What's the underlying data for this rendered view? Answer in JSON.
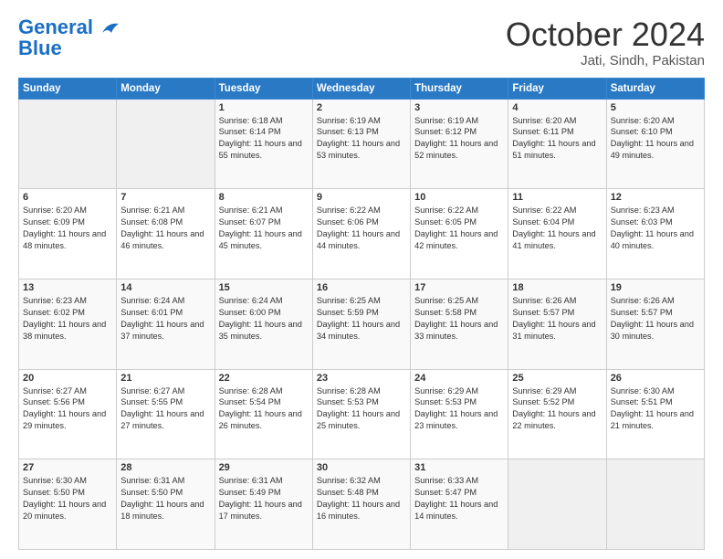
{
  "header": {
    "logo_line1": "General",
    "logo_line2": "Blue",
    "title": "October 2024",
    "location": "Jati, Sindh, Pakistan"
  },
  "days_of_week": [
    "Sunday",
    "Monday",
    "Tuesday",
    "Wednesday",
    "Thursday",
    "Friday",
    "Saturday"
  ],
  "weeks": [
    [
      {
        "day": "",
        "sunrise": "",
        "sunset": "",
        "daylight": ""
      },
      {
        "day": "",
        "sunrise": "",
        "sunset": "",
        "daylight": ""
      },
      {
        "day": "1",
        "sunrise": "Sunrise: 6:18 AM",
        "sunset": "Sunset: 6:14 PM",
        "daylight": "Daylight: 11 hours and 55 minutes."
      },
      {
        "day": "2",
        "sunrise": "Sunrise: 6:19 AM",
        "sunset": "Sunset: 6:13 PM",
        "daylight": "Daylight: 11 hours and 53 minutes."
      },
      {
        "day": "3",
        "sunrise": "Sunrise: 6:19 AM",
        "sunset": "Sunset: 6:12 PM",
        "daylight": "Daylight: 11 hours and 52 minutes."
      },
      {
        "day": "4",
        "sunrise": "Sunrise: 6:20 AM",
        "sunset": "Sunset: 6:11 PM",
        "daylight": "Daylight: 11 hours and 51 minutes."
      },
      {
        "day": "5",
        "sunrise": "Sunrise: 6:20 AM",
        "sunset": "Sunset: 6:10 PM",
        "daylight": "Daylight: 11 hours and 49 minutes."
      }
    ],
    [
      {
        "day": "6",
        "sunrise": "Sunrise: 6:20 AM",
        "sunset": "Sunset: 6:09 PM",
        "daylight": "Daylight: 11 hours and 48 minutes."
      },
      {
        "day": "7",
        "sunrise": "Sunrise: 6:21 AM",
        "sunset": "Sunset: 6:08 PM",
        "daylight": "Daylight: 11 hours and 46 minutes."
      },
      {
        "day": "8",
        "sunrise": "Sunrise: 6:21 AM",
        "sunset": "Sunset: 6:07 PM",
        "daylight": "Daylight: 11 hours and 45 minutes."
      },
      {
        "day": "9",
        "sunrise": "Sunrise: 6:22 AM",
        "sunset": "Sunset: 6:06 PM",
        "daylight": "Daylight: 11 hours and 44 minutes."
      },
      {
        "day": "10",
        "sunrise": "Sunrise: 6:22 AM",
        "sunset": "Sunset: 6:05 PM",
        "daylight": "Daylight: 11 hours and 42 minutes."
      },
      {
        "day": "11",
        "sunrise": "Sunrise: 6:22 AM",
        "sunset": "Sunset: 6:04 PM",
        "daylight": "Daylight: 11 hours and 41 minutes."
      },
      {
        "day": "12",
        "sunrise": "Sunrise: 6:23 AM",
        "sunset": "Sunset: 6:03 PM",
        "daylight": "Daylight: 11 hours and 40 minutes."
      }
    ],
    [
      {
        "day": "13",
        "sunrise": "Sunrise: 6:23 AM",
        "sunset": "Sunset: 6:02 PM",
        "daylight": "Daylight: 11 hours and 38 minutes."
      },
      {
        "day": "14",
        "sunrise": "Sunrise: 6:24 AM",
        "sunset": "Sunset: 6:01 PM",
        "daylight": "Daylight: 11 hours and 37 minutes."
      },
      {
        "day": "15",
        "sunrise": "Sunrise: 6:24 AM",
        "sunset": "Sunset: 6:00 PM",
        "daylight": "Daylight: 11 hours and 35 minutes."
      },
      {
        "day": "16",
        "sunrise": "Sunrise: 6:25 AM",
        "sunset": "Sunset: 5:59 PM",
        "daylight": "Daylight: 11 hours and 34 minutes."
      },
      {
        "day": "17",
        "sunrise": "Sunrise: 6:25 AM",
        "sunset": "Sunset: 5:58 PM",
        "daylight": "Daylight: 11 hours and 33 minutes."
      },
      {
        "day": "18",
        "sunrise": "Sunrise: 6:26 AM",
        "sunset": "Sunset: 5:57 PM",
        "daylight": "Daylight: 11 hours and 31 minutes."
      },
      {
        "day": "19",
        "sunrise": "Sunrise: 6:26 AM",
        "sunset": "Sunset: 5:57 PM",
        "daylight": "Daylight: 11 hours and 30 minutes."
      }
    ],
    [
      {
        "day": "20",
        "sunrise": "Sunrise: 6:27 AM",
        "sunset": "Sunset: 5:56 PM",
        "daylight": "Daylight: 11 hours and 29 minutes."
      },
      {
        "day": "21",
        "sunrise": "Sunrise: 6:27 AM",
        "sunset": "Sunset: 5:55 PM",
        "daylight": "Daylight: 11 hours and 27 minutes."
      },
      {
        "day": "22",
        "sunrise": "Sunrise: 6:28 AM",
        "sunset": "Sunset: 5:54 PM",
        "daylight": "Daylight: 11 hours and 26 minutes."
      },
      {
        "day": "23",
        "sunrise": "Sunrise: 6:28 AM",
        "sunset": "Sunset: 5:53 PM",
        "daylight": "Daylight: 11 hours and 25 minutes."
      },
      {
        "day": "24",
        "sunrise": "Sunrise: 6:29 AM",
        "sunset": "Sunset: 5:53 PM",
        "daylight": "Daylight: 11 hours and 23 minutes."
      },
      {
        "day": "25",
        "sunrise": "Sunrise: 6:29 AM",
        "sunset": "Sunset: 5:52 PM",
        "daylight": "Daylight: 11 hours and 22 minutes."
      },
      {
        "day": "26",
        "sunrise": "Sunrise: 6:30 AM",
        "sunset": "Sunset: 5:51 PM",
        "daylight": "Daylight: 11 hours and 21 minutes."
      }
    ],
    [
      {
        "day": "27",
        "sunrise": "Sunrise: 6:30 AM",
        "sunset": "Sunset: 5:50 PM",
        "daylight": "Daylight: 11 hours and 20 minutes."
      },
      {
        "day": "28",
        "sunrise": "Sunrise: 6:31 AM",
        "sunset": "Sunset: 5:50 PM",
        "daylight": "Daylight: 11 hours and 18 minutes."
      },
      {
        "day": "29",
        "sunrise": "Sunrise: 6:31 AM",
        "sunset": "Sunset: 5:49 PM",
        "daylight": "Daylight: 11 hours and 17 minutes."
      },
      {
        "day": "30",
        "sunrise": "Sunrise: 6:32 AM",
        "sunset": "Sunset: 5:48 PM",
        "daylight": "Daylight: 11 hours and 16 minutes."
      },
      {
        "day": "31",
        "sunrise": "Sunrise: 6:33 AM",
        "sunset": "Sunset: 5:47 PM",
        "daylight": "Daylight: 11 hours and 14 minutes."
      },
      {
        "day": "",
        "sunrise": "",
        "sunset": "",
        "daylight": ""
      },
      {
        "day": "",
        "sunrise": "",
        "sunset": "",
        "daylight": ""
      }
    ]
  ]
}
